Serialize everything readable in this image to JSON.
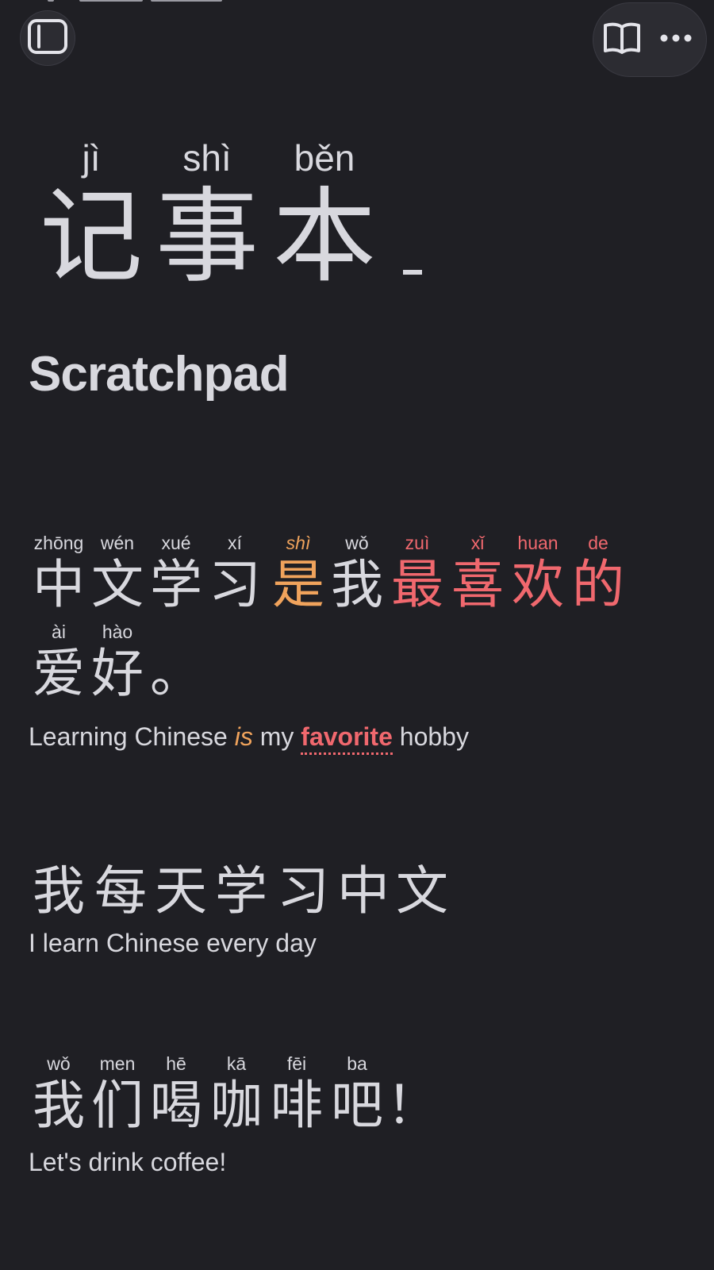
{
  "toolbar": {
    "sidebar_icon": "sidebar-toggle-icon",
    "book_icon": "book-icon",
    "more_icon": "more-horizontal-icon"
  },
  "title": {
    "words": [
      {
        "pinyin": "jì",
        "hanzi": "记"
      },
      {
        "pinyin": "shì",
        "hanzi": "事"
      },
      {
        "pinyin": "běn",
        "hanzi": "本"
      }
    ],
    "subtitle": "Scratchpad"
  },
  "sentences": [
    {
      "line1": [
        {
          "pinyin": "zhōng",
          "hanzi": "中",
          "style": ""
        },
        {
          "pinyin": "wén",
          "hanzi": "文",
          "style": ""
        },
        {
          "pinyin": "xué",
          "hanzi": "学",
          "style": ""
        },
        {
          "pinyin": "xí",
          "hanzi": "习",
          "style": ""
        },
        {
          "pinyin": "shì",
          "hanzi": "是",
          "style": "orange"
        },
        {
          "pinyin": "wǒ",
          "hanzi": "我",
          "style": ""
        },
        {
          "pinyin": "zuì",
          "hanzi": "最",
          "style": "red"
        },
        {
          "pinyin": "xǐ",
          "hanzi": "喜",
          "style": "red"
        },
        {
          "pinyin": "huan",
          "hanzi": "欢",
          "style": "red"
        },
        {
          "pinyin": "de",
          "hanzi": "的",
          "style": "red"
        }
      ],
      "line2": [
        {
          "pinyin": "ài",
          "hanzi": "爱",
          "style": ""
        },
        {
          "pinyin": "hào",
          "hanzi": "好",
          "style": ""
        },
        {
          "pinyin": "",
          "hanzi": "。",
          "style": ""
        }
      ],
      "translation": {
        "part1": "Learning Chinese ",
        "part2": "is",
        "part3": " my ",
        "part4": "favorite",
        "part5": " hobby"
      }
    },
    {
      "line1": [
        {
          "pinyin": "",
          "hanzi": "我",
          "style": ""
        },
        {
          "pinyin": "",
          "hanzi": "每",
          "style": ""
        },
        {
          "pinyin": "",
          "hanzi": "天",
          "style": ""
        },
        {
          "pinyin": "",
          "hanzi": "学",
          "style": ""
        },
        {
          "pinyin": "",
          "hanzi": "习",
          "style": ""
        },
        {
          "pinyin": "",
          "hanzi": "中",
          "style": ""
        },
        {
          "pinyin": "",
          "hanzi": "文",
          "style": ""
        }
      ],
      "translation": "I learn Chinese every day"
    },
    {
      "line1": [
        {
          "pinyin": "wǒ",
          "hanzi": "我",
          "style": ""
        },
        {
          "pinyin": "men",
          "hanzi": "们",
          "style": ""
        },
        {
          "pinyin": "hē",
          "hanzi": "喝",
          "style": ""
        },
        {
          "pinyin": "kā",
          "hanzi": "咖",
          "style": ""
        },
        {
          "pinyin": "fēi",
          "hanzi": "啡",
          "style": ""
        },
        {
          "pinyin": "ba",
          "hanzi": "吧",
          "style": ""
        },
        {
          "pinyin": "",
          "hanzi": "！",
          "style": ""
        }
      ],
      "translation": "Let's drink coffee!"
    }
  ],
  "colors": {
    "background": "#1f1f24",
    "text": "#d8d8de",
    "orange": "#f0a35c",
    "red": "#f0686e"
  }
}
